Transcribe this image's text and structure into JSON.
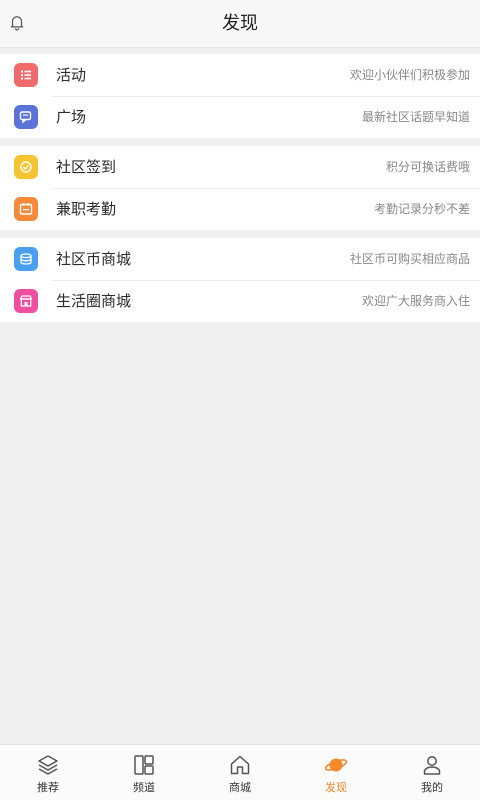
{
  "header": {
    "title": "发现",
    "bell_icon": "bell-icon"
  },
  "sections": [
    {
      "items": [
        {
          "icon": "list-icon",
          "color": "#ef6b6b",
          "label": "活动",
          "desc": "欢迎小伙伴们积极参加"
        },
        {
          "icon": "chat-icon",
          "color": "#5b73d8",
          "label": "广场",
          "desc": "最新社区话题早知道"
        }
      ]
    },
    {
      "items": [
        {
          "icon": "check-circle-icon",
          "color": "#f5c531",
          "label": "社区签到",
          "desc": "积分可换话费哦"
        },
        {
          "icon": "calendar-icon",
          "color": "#f58a3b",
          "label": "兼职考勤",
          "desc": "考勤记录分秒不差"
        }
      ]
    },
    {
      "items": [
        {
          "icon": "coins-icon",
          "color": "#4aa0f0",
          "label": "社区币商城",
          "desc": "社区币可购买相应商品"
        },
        {
          "icon": "store-icon",
          "color": "#ee4f9e",
          "label": "生活圈商城",
          "desc": "欢迎广大服务商入住"
        }
      ]
    }
  ],
  "tabbar": {
    "tabs": [
      {
        "icon": "layers-icon",
        "label": "推荐",
        "active": false
      },
      {
        "icon": "grid-icon",
        "label": "频道",
        "active": false
      },
      {
        "icon": "home-icon",
        "label": "商城",
        "active": false
      },
      {
        "icon": "planet-icon",
        "label": "发现",
        "active": true
      },
      {
        "icon": "user-icon",
        "label": "我的",
        "active": false
      }
    ],
    "active_color": "#f28a2b"
  }
}
